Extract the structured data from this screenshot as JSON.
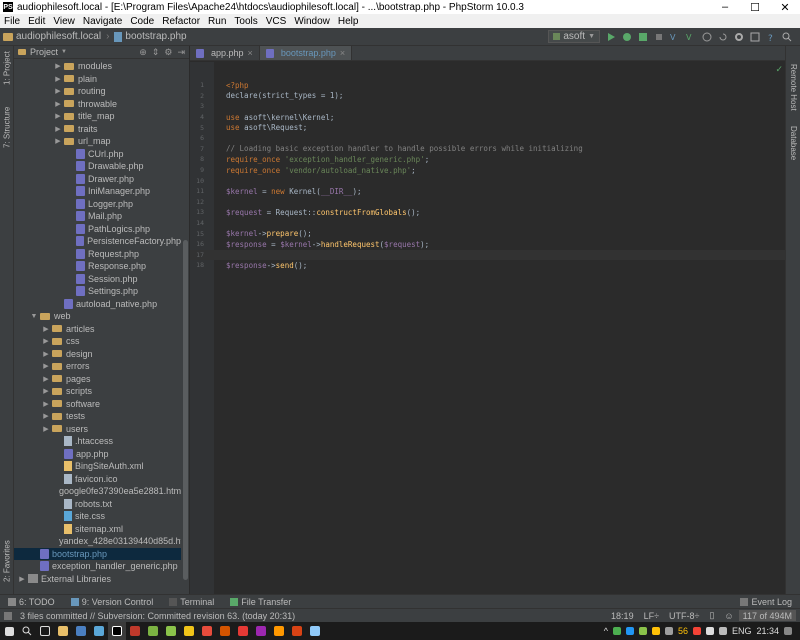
{
  "window": {
    "title": "audiophilesoft.local - [E:\\Program Files\\Apache24\\htdocs\\audiophilesoft.local] - ...\\bootstrap.php - PhpStorm 10.0.3",
    "minimize": "–",
    "maximize": "☐",
    "close": "✕"
  },
  "menu": [
    "File",
    "Edit",
    "View",
    "Navigate",
    "Code",
    "Refactor",
    "Run",
    "Tools",
    "VCS",
    "Window",
    "Help"
  ],
  "navbar": {
    "crumb_project": "audiophilesoft.local",
    "crumb_file": "bootstrap.php",
    "run_config": "asoft"
  },
  "left_tabs": {
    "project": "1: Project",
    "structure": "7: Structure",
    "favorites": "2: Favorites"
  },
  "right_tabs": {
    "remote_host": "Remote Host",
    "database": "Database"
  },
  "project_panel": {
    "header": "Project",
    "tree": [
      {
        "label": "modules",
        "type": "folder",
        "depth": 3,
        "arrow": "▶"
      },
      {
        "label": "plain",
        "type": "folder",
        "depth": 3,
        "arrow": "▶"
      },
      {
        "label": "routing",
        "type": "folder",
        "depth": 3,
        "arrow": "▶"
      },
      {
        "label": "throwable",
        "type": "folder",
        "depth": 3,
        "arrow": "▶"
      },
      {
        "label": "title_map",
        "type": "folder",
        "depth": 3,
        "arrow": "▶"
      },
      {
        "label": "traits",
        "type": "folder",
        "depth": 3,
        "arrow": "▶"
      },
      {
        "label": "url_map",
        "type": "folder",
        "depth": 3,
        "arrow": "▶"
      },
      {
        "label": "CUrl.php",
        "type": "php",
        "depth": 4,
        "arrow": ""
      },
      {
        "label": "Drawable.php",
        "type": "php",
        "depth": 4,
        "arrow": ""
      },
      {
        "label": "Drawer.php",
        "type": "php",
        "depth": 4,
        "arrow": ""
      },
      {
        "label": "IniManager.php",
        "type": "php",
        "depth": 4,
        "arrow": ""
      },
      {
        "label": "Logger.php",
        "type": "php",
        "depth": 4,
        "arrow": ""
      },
      {
        "label": "Mail.php",
        "type": "php",
        "depth": 4,
        "arrow": ""
      },
      {
        "label": "PathLogics.php",
        "type": "php",
        "depth": 4,
        "arrow": ""
      },
      {
        "label": "PersistenceFactory.php",
        "type": "php",
        "depth": 4,
        "arrow": ""
      },
      {
        "label": "Request.php",
        "type": "php",
        "depth": 4,
        "arrow": ""
      },
      {
        "label": "Response.php",
        "type": "php",
        "depth": 4,
        "arrow": ""
      },
      {
        "label": "Session.php",
        "type": "php",
        "depth": 4,
        "arrow": ""
      },
      {
        "label": "Settings.php",
        "type": "php",
        "depth": 4,
        "arrow": ""
      },
      {
        "label": "autoload_native.php",
        "type": "php",
        "depth": 3,
        "arrow": ""
      },
      {
        "label": "web",
        "type": "folder",
        "depth": 1,
        "arrow": "▼"
      },
      {
        "label": "articles",
        "type": "folder",
        "depth": 2,
        "arrow": "▶"
      },
      {
        "label": "css",
        "type": "folder",
        "depth": 2,
        "arrow": "▶"
      },
      {
        "label": "design",
        "type": "folder",
        "depth": 2,
        "arrow": "▶"
      },
      {
        "label": "errors",
        "type": "folder",
        "depth": 2,
        "arrow": "▶"
      },
      {
        "label": "pages",
        "type": "folder",
        "depth": 2,
        "arrow": "▶"
      },
      {
        "label": "scripts",
        "type": "folder",
        "depth": 2,
        "arrow": "▶"
      },
      {
        "label": "software",
        "type": "folder",
        "depth": 2,
        "arrow": "▶"
      },
      {
        "label": "tests",
        "type": "folder",
        "depth": 2,
        "arrow": "▶"
      },
      {
        "label": "users",
        "type": "folder",
        "depth": 2,
        "arrow": "▶"
      },
      {
        "label": ".htaccess",
        "type": "file",
        "depth": 3,
        "arrow": ""
      },
      {
        "label": "app.php",
        "type": "php",
        "depth": 3,
        "arrow": ""
      },
      {
        "label": "BingSiteAuth.xml",
        "type": "xml",
        "depth": 3,
        "arrow": ""
      },
      {
        "label": "favicon.ico",
        "type": "file",
        "depth": 3,
        "arrow": ""
      },
      {
        "label": "google0fe37390ea5e2881.html",
        "type": "html",
        "depth": 3,
        "arrow": ""
      },
      {
        "label": "robots.txt",
        "type": "file",
        "depth": 3,
        "arrow": ""
      },
      {
        "label": "site.css",
        "type": "css",
        "depth": 3,
        "arrow": ""
      },
      {
        "label": "sitemap.xml",
        "type": "xml",
        "depth": 3,
        "arrow": ""
      },
      {
        "label": "yandex_428e03139440d85d.html",
        "type": "html",
        "depth": 3,
        "arrow": ""
      },
      {
        "label": "bootstrap.php",
        "type": "php",
        "depth": 1,
        "arrow": "",
        "selected": true
      },
      {
        "label": "exception_handler_generic.php",
        "type": "php",
        "depth": 1,
        "arrow": ""
      },
      {
        "label": "External Libraries",
        "type": "lib",
        "depth": 0,
        "arrow": "▶"
      }
    ]
  },
  "tabs": [
    {
      "label": "app.php",
      "active": false
    },
    {
      "label": "bootstrap.php",
      "active": true
    }
  ],
  "code_lines": [
    {
      "n": "1",
      "parts": [
        [
          "kw",
          "<?php"
        ]
      ]
    },
    {
      "n": "2",
      "parts": [
        [
          "tx",
          "declare(strict_types = 1);"
        ]
      ]
    },
    {
      "n": "3",
      "parts": []
    },
    {
      "n": "4",
      "parts": [
        [
          "kw",
          "use "
        ],
        [
          "tx",
          "asoft\\kernel\\Kernel;"
        ]
      ]
    },
    {
      "n": "5",
      "parts": [
        [
          "kw",
          "use "
        ],
        [
          "tx",
          "asoft\\Request;"
        ]
      ]
    },
    {
      "n": "6",
      "parts": []
    },
    {
      "n": "7",
      "parts": [
        [
          "cmt",
          "// Loading basic exception handler to handle possible errors while initializing"
        ]
      ]
    },
    {
      "n": "8",
      "parts": [
        [
          "kw",
          "require_once "
        ],
        [
          "str",
          "'exception_handler_generic.php'"
        ],
        [
          "tx",
          ";"
        ]
      ]
    },
    {
      "n": "9",
      "parts": [
        [
          "kw",
          "require_once "
        ],
        [
          "str",
          "'vendor/autoload_native.php'"
        ],
        [
          "tx",
          ";"
        ]
      ]
    },
    {
      "n": "10",
      "parts": []
    },
    {
      "n": "11",
      "parts": [
        [
          "var",
          "$kernel"
        ],
        [
          "tx",
          " = "
        ],
        [
          "kw",
          "new "
        ],
        [
          "tx",
          "Kernel("
        ],
        [
          "var",
          "__DIR__"
        ],
        [
          "tx",
          ");"
        ]
      ]
    },
    {
      "n": "12",
      "parts": []
    },
    {
      "n": "13",
      "parts": [
        [
          "var",
          "$request"
        ],
        [
          "tx",
          " = Request::"
        ],
        [
          "fn",
          "constructFromGlobals"
        ],
        [
          "tx",
          "();"
        ]
      ]
    },
    {
      "n": "14",
      "parts": []
    },
    {
      "n": "15",
      "parts": [
        [
          "var",
          "$kernel"
        ],
        [
          "tx",
          "->"
        ],
        [
          "fn",
          "prepare"
        ],
        [
          "tx",
          "();"
        ]
      ]
    },
    {
      "n": "16",
      "parts": [
        [
          "var",
          "$response"
        ],
        [
          "tx",
          " = "
        ],
        [
          "var",
          "$kernel"
        ],
        [
          "tx",
          "->"
        ],
        [
          "fn",
          "handleRequest"
        ],
        [
          "tx",
          "("
        ],
        [
          "var",
          "$request"
        ],
        [
          "tx",
          ");"
        ]
      ]
    },
    {
      "n": "17",
      "parts": [],
      "current": true
    },
    {
      "n": "18",
      "parts": [
        [
          "var",
          "$response"
        ],
        [
          "tx",
          "->"
        ],
        [
          "fn",
          "send"
        ],
        [
          "tx",
          "();"
        ]
      ]
    }
  ],
  "bottom_tools": {
    "todo": "6: TODO",
    "vcs": "9: Version Control",
    "terminal": "Terminal",
    "file_transfer": "File Transfer",
    "event_log": "Event Log"
  },
  "status": {
    "message": "3 files committed // Subversion: Committed revision 63. (today 20:31)",
    "position": "18:19",
    "line_sep": "LF÷",
    "encoding": "UTF-8÷",
    "memory": "117 of 494M"
  },
  "taskbar": {
    "lang": "ENG",
    "time": "21:34",
    "tray_num": "56"
  },
  "colors": {
    "bg_editor": "#2b2b2b",
    "bg_panel": "#3c3f41",
    "keyword": "#cc7832",
    "variable": "#9876aa",
    "string": "#6a8759",
    "comment": "#808080",
    "function": "#ffc66d"
  }
}
